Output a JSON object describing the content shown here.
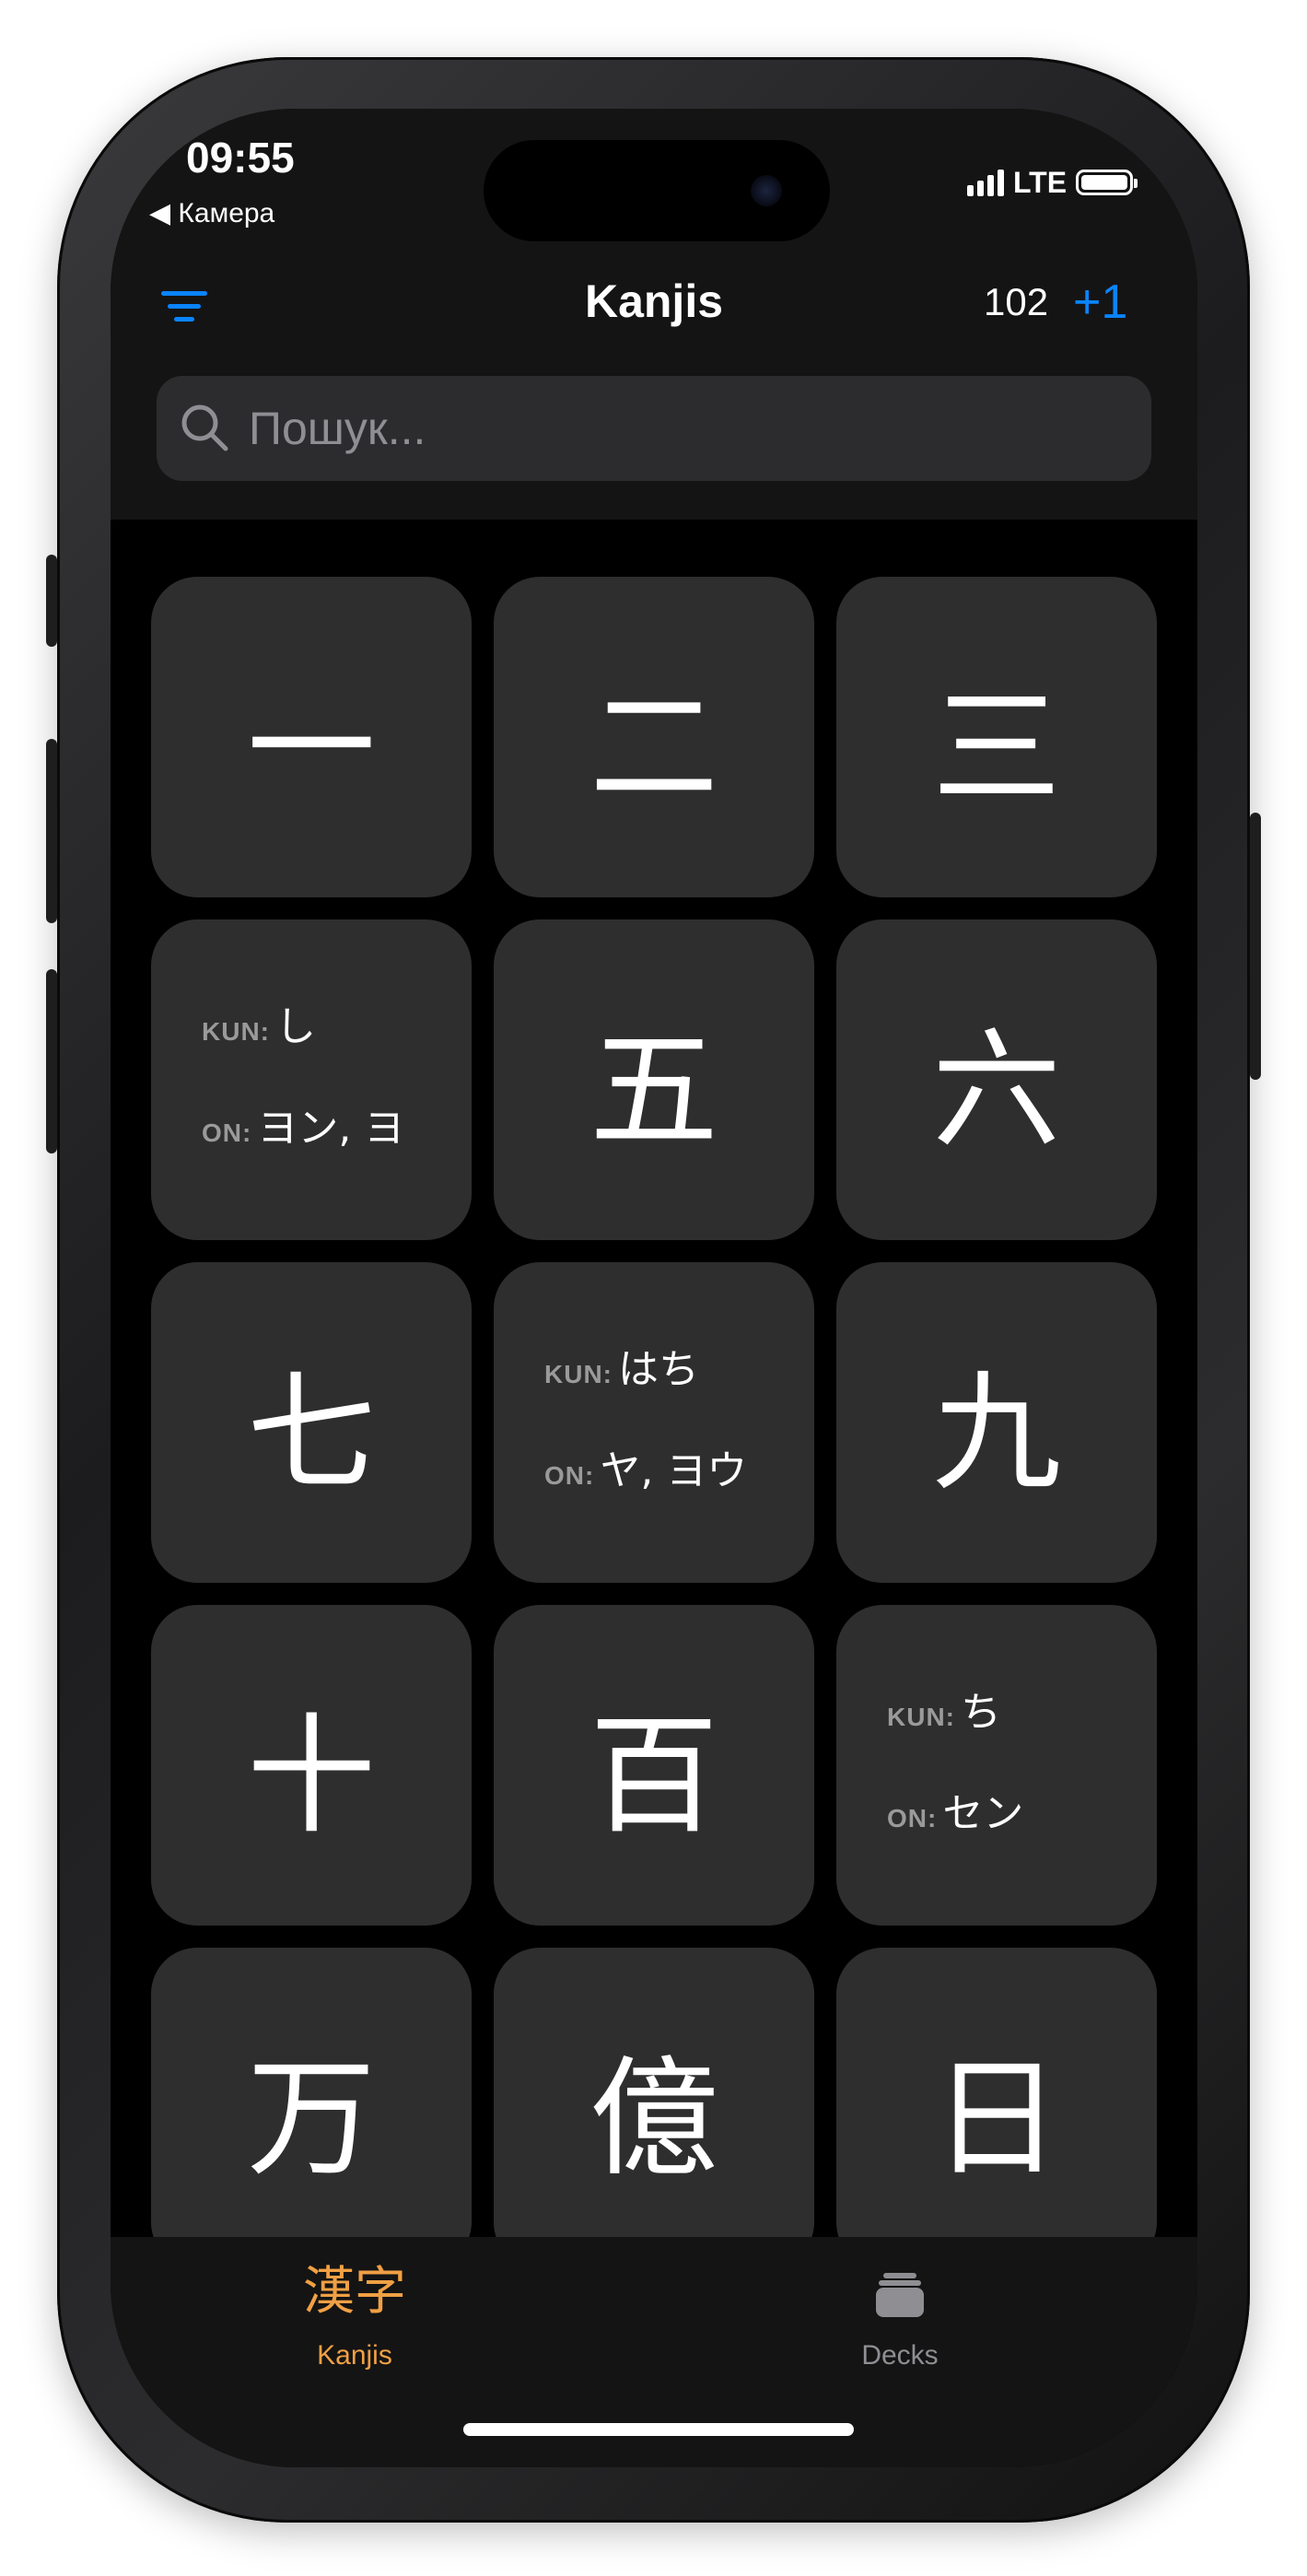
{
  "status_bar": {
    "time": "09:55",
    "back_label": "◀ Камера",
    "network": "LTE"
  },
  "nav": {
    "title": "Kanjis",
    "count": "102",
    "add_label": "+1"
  },
  "search": {
    "placeholder": "Пошук..."
  },
  "cards": [
    {
      "kanji": "一"
    },
    {
      "kanji": "二"
    },
    {
      "kanji": "三"
    },
    {
      "kun_label": "KUN:",
      "kun": "し",
      "on_label": "ON:",
      "on": "ヨン, ヨ"
    },
    {
      "kanji": "五"
    },
    {
      "kanji": "六"
    },
    {
      "kanji": "七"
    },
    {
      "kun_label": "KUN:",
      "kun": "はち",
      "on_label": "ON:",
      "on": "ヤ, ヨウ"
    },
    {
      "kanji": "九"
    },
    {
      "kanji": "十"
    },
    {
      "kanji": "百"
    },
    {
      "kun_label": "KUN:",
      "kun": "ち",
      "on_label": "ON:",
      "on": "セン"
    },
    {
      "kanji": "万"
    },
    {
      "kanji": "億"
    },
    {
      "kanji": "日"
    }
  ],
  "tabs": [
    {
      "icon": "漢字",
      "label": "Kanjis",
      "active": true
    },
    {
      "icon": "stack-icon",
      "label": "Decks",
      "active": false
    }
  ],
  "colors": {
    "accent_blue": "#0a84ff",
    "active_tab": "#f0a044",
    "inactive_tab": "#8e8e93",
    "card_bg": "#2e2e2e"
  }
}
